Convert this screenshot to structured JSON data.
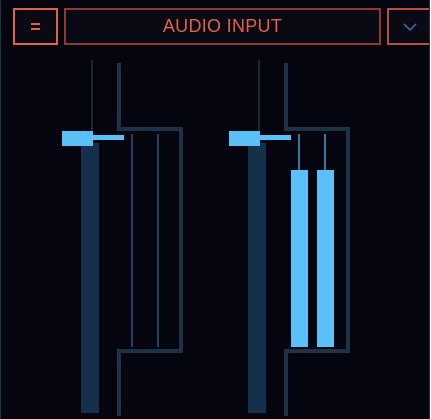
{
  "header": {
    "title": "AUDIO INPUT",
    "menu_icon": "hamburger-icon",
    "dropdown_icon": "chevron-down-icon"
  },
  "colors": {
    "background": "#05050f",
    "accent": "#e0604a",
    "track": "#14304a",
    "outline": "#1e3246",
    "active": "#5bc0f8"
  },
  "channels": [
    {
      "fader_level": 0.77,
      "meter_left_level": 0.0,
      "meter_right_level": 0.0
    },
    {
      "fader_level": 0.77,
      "meter_left_level": 0.81,
      "meter_right_level": 0.81
    }
  ]
}
